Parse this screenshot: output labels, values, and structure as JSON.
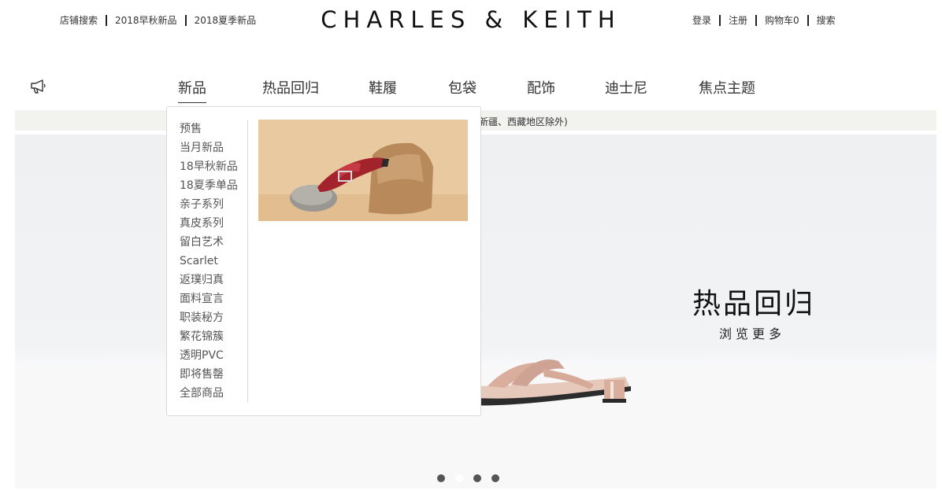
{
  "header": {
    "brand": "CHARLES & KEITH",
    "left_links": [
      "店铺搜索",
      "2018早秋新品",
      "2018夏季新品"
    ],
    "right_links": [
      "登录",
      "注册",
      "购物车0",
      "搜索"
    ]
  },
  "nav": {
    "items": [
      "新品",
      "热品回归",
      "鞋履",
      "包袋",
      "配饰",
      "迪士尼",
      "焦点主题"
    ],
    "active_index": 0
  },
  "shipping_notice": "新疆、西藏地区除外)",
  "dropdown": {
    "items": [
      "预售",
      "当月新品",
      "18早秋新品",
      "18夏季单品",
      "亲子系列",
      "真皮系列",
      "留白艺术",
      "Scarlet",
      "返璞归真",
      "面料宣言",
      "职装秘方",
      "繁花锦簇",
      "透明PVC",
      "即将售罄",
      "全部商品"
    ]
  },
  "hero": {
    "title": "热品回归",
    "subtitle": "浏览更多"
  },
  "carousel": {
    "count": 4,
    "active_index": 1
  },
  "icons": {
    "announcement": "megaphone-icon"
  },
  "colors": {
    "text": "#222222",
    "shipbar_bg": "#f2f2ef",
    "hero_bg": "#eef0f2"
  }
}
